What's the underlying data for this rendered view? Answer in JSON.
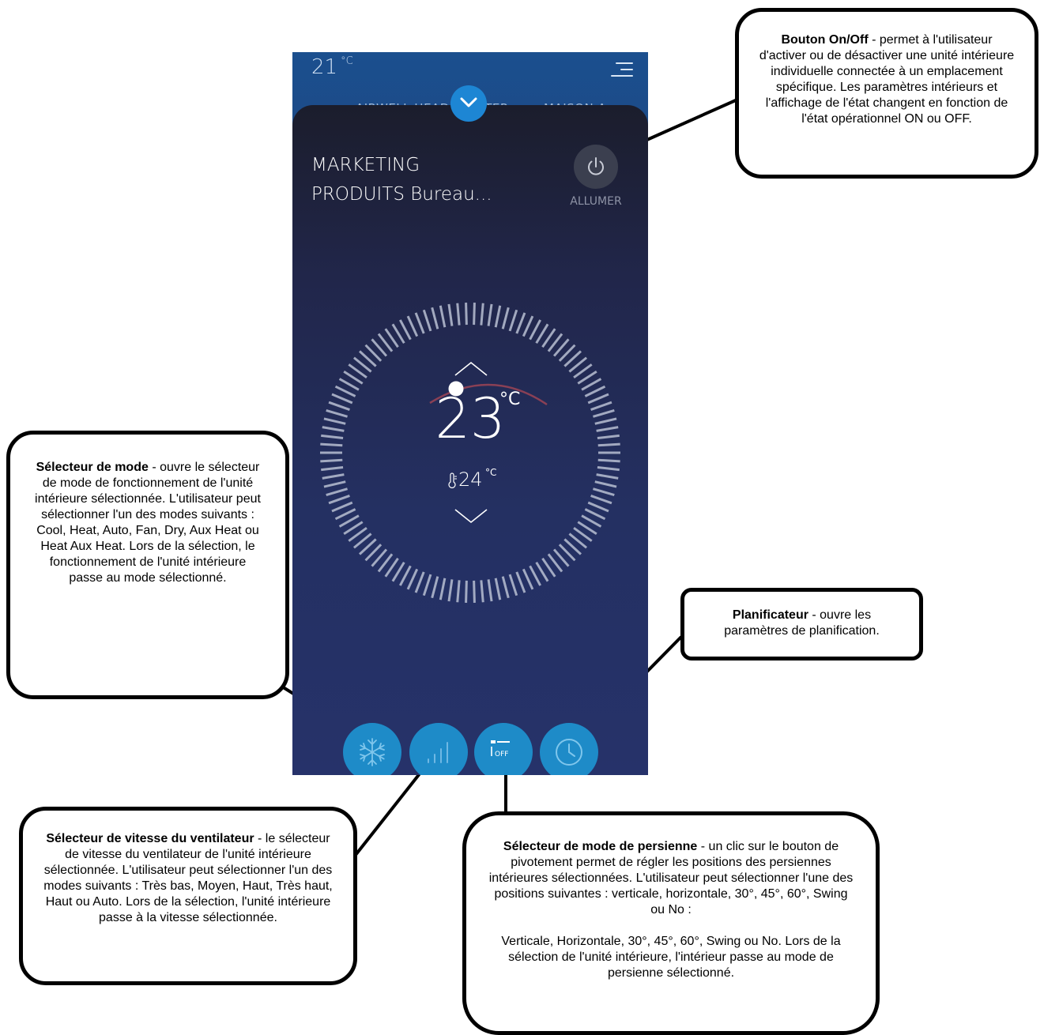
{
  "status_bar": {
    "outdoor_temp": "21",
    "outdoor_unit": "°C"
  },
  "location_tabs": [
    "AIRWELL HEADQUARTER",
    "MAISON A"
  ],
  "unit": {
    "name_line1": "MARKETING",
    "name_line2": "PRODUITS Bureau...",
    "power_label": "ALLUMER",
    "setpoint": "23",
    "setpoint_unit": "°C",
    "room_temp": "24",
    "room_temp_unit": "°C",
    "louver_state": "OFF"
  },
  "icons": {
    "menu": "menu-icon",
    "collapse": "chevron-down-icon",
    "power": "power-icon",
    "mode": "snowflake-icon",
    "fan": "fan-speed-bars-icon",
    "louver": "louver-icon",
    "schedule": "clock-icon",
    "room_temp": "thermometer-icon"
  },
  "colors": {
    "accent": "#1e8bc8",
    "panel_dark": "#1b1d2c",
    "panel_blue": "#26326a",
    "dial_arc": "#b05060"
  },
  "callouts": {
    "power": {
      "title": "Bouton On/Off",
      "text": " - permet à l'utilisateur d'activer ou de désactiver une unité intérieure individuelle connectée à un emplacement spécifique. Les paramètres intérieurs et l'affichage de l'état changent en fonction de l'état opérationnel ON ou OFF."
    },
    "mode": {
      "title": "Sélecteur de mode",
      "text": " - ouvre le sélecteur de mode de fonctionnement de l'unité intérieure sélectionnée. L'utilisateur peut sélectionner l'un des modes suivants : Cool, Heat, Auto, Fan, Dry, Aux Heat ou Heat Aux Heat. Lors de la sélection, le fonctionnement de l'unité intérieure passe au mode sélectionné."
    },
    "scheduler": {
      "title": "Planificateur",
      "text": " - ouvre les paramètres de planification."
    },
    "fan": {
      "title": "Sélecteur de vitesse du ventilateur",
      "text": " - le sélecteur de vitesse du ventilateur de l'unité intérieure sélectionnée. L'utilisateur peut sélectionner l'un des modes suivants : Très bas, Moyen, Haut, Très haut, Haut ou Auto. Lors de la sélection, l'unité intérieure passe à la vitesse sélectionnée."
    },
    "louver": {
      "title": "Sélecteur de mode de persienne",
      "text": " - un clic sur le bouton de pivotement permet de régler les positions des persiennes intérieures sélectionnées. L'utilisateur peut sélectionner l'une des positions suivantes : verticale, horizontale, 30°, 45°, 60°, Swing ou No :\n\nVerticale, Horizontale, 30°, 45°, 60°, Swing ou No. Lors de la sélection de l'unité intérieure, l'intérieur passe au mode de persienne sélectionné."
    }
  }
}
